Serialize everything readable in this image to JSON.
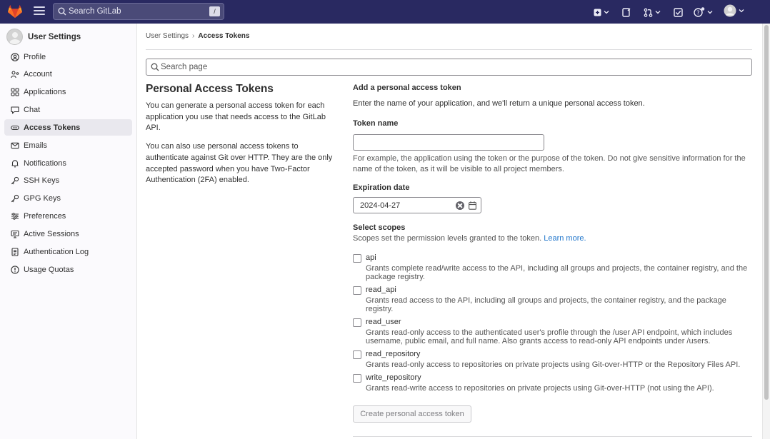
{
  "topbar": {
    "search_placeholder": "Search GitLab",
    "search_shortcut": "/"
  },
  "sidebar": {
    "title": "User Settings",
    "items": [
      {
        "label": "Profile",
        "icon": "profile-icon"
      },
      {
        "label": "Account",
        "icon": "account-icon"
      },
      {
        "label": "Applications",
        "icon": "applications-icon"
      },
      {
        "label": "Chat",
        "icon": "chat-icon"
      },
      {
        "label": "Access Tokens",
        "icon": "token-icon",
        "active": true
      },
      {
        "label": "Emails",
        "icon": "mail-icon"
      },
      {
        "label": "Notifications",
        "icon": "bell-icon"
      },
      {
        "label": "SSH Keys",
        "icon": "key-icon"
      },
      {
        "label": "GPG Keys",
        "icon": "key-icon"
      },
      {
        "label": "Preferences",
        "icon": "preferences-icon"
      },
      {
        "label": "Active Sessions",
        "icon": "monitor-icon"
      },
      {
        "label": "Authentication Log",
        "icon": "log-icon"
      },
      {
        "label": "Usage Quotas",
        "icon": "quota-icon"
      }
    ]
  },
  "breadcrumb": {
    "parent": "User Settings",
    "current": "Access Tokens"
  },
  "page_search": {
    "placeholder": "Search page"
  },
  "intro": {
    "title": "Personal Access Tokens",
    "p1": "You can generate a personal access token for each application you use that needs access to the GitLab API.",
    "p2": "You can also use personal access tokens to authenticate against Git over HTTP. They are the only accepted password when you have Two-Factor Authentication (2FA) enabled."
  },
  "form": {
    "heading": "Add a personal access token",
    "subheading": "Enter the name of your application, and we'll return a unique personal access token.",
    "token_name_label": "Token name",
    "token_name_value": "",
    "token_name_help": "For example, the application using the token or the purpose of the token. Do not give sensitive information for the name of the token, as it will be visible to all project members.",
    "expiration_label": "Expiration date",
    "expiration_value": "2024-04-27",
    "scopes_label": "Select scopes",
    "scopes_help": "Scopes set the permission levels granted to the token.",
    "scopes_link": "Learn more.",
    "scopes": [
      {
        "name": "api",
        "checked": false,
        "description": "Grants complete read/write access to the API, including all groups and projects, the container registry, and the package registry."
      },
      {
        "name": "read_api",
        "checked": false,
        "description": "Grants read access to the API, including all groups and projects, the container registry, and the package registry."
      },
      {
        "name": "read_user",
        "checked": false,
        "description": "Grants read-only access to the authenticated user's profile through the /user API endpoint, which includes username, public email, and full name. Also grants access to read-only API endpoints under /users."
      },
      {
        "name": "read_repository",
        "checked": false,
        "description": "Grants read-only access to repositories on private projects using Git-over-HTTP or the Repository Files API."
      },
      {
        "name": "write_repository",
        "checked": false,
        "description": "Grants read-write access to repositories on private projects using Git-over-HTTP (not using the API)."
      }
    ],
    "submit_label": "Create personal access token"
  },
  "colors": {
    "navbar": "#292961",
    "link": "#1f75cb",
    "sidebar_bg": "#fbfafd",
    "active_item_bg": "#e9e8ee"
  }
}
